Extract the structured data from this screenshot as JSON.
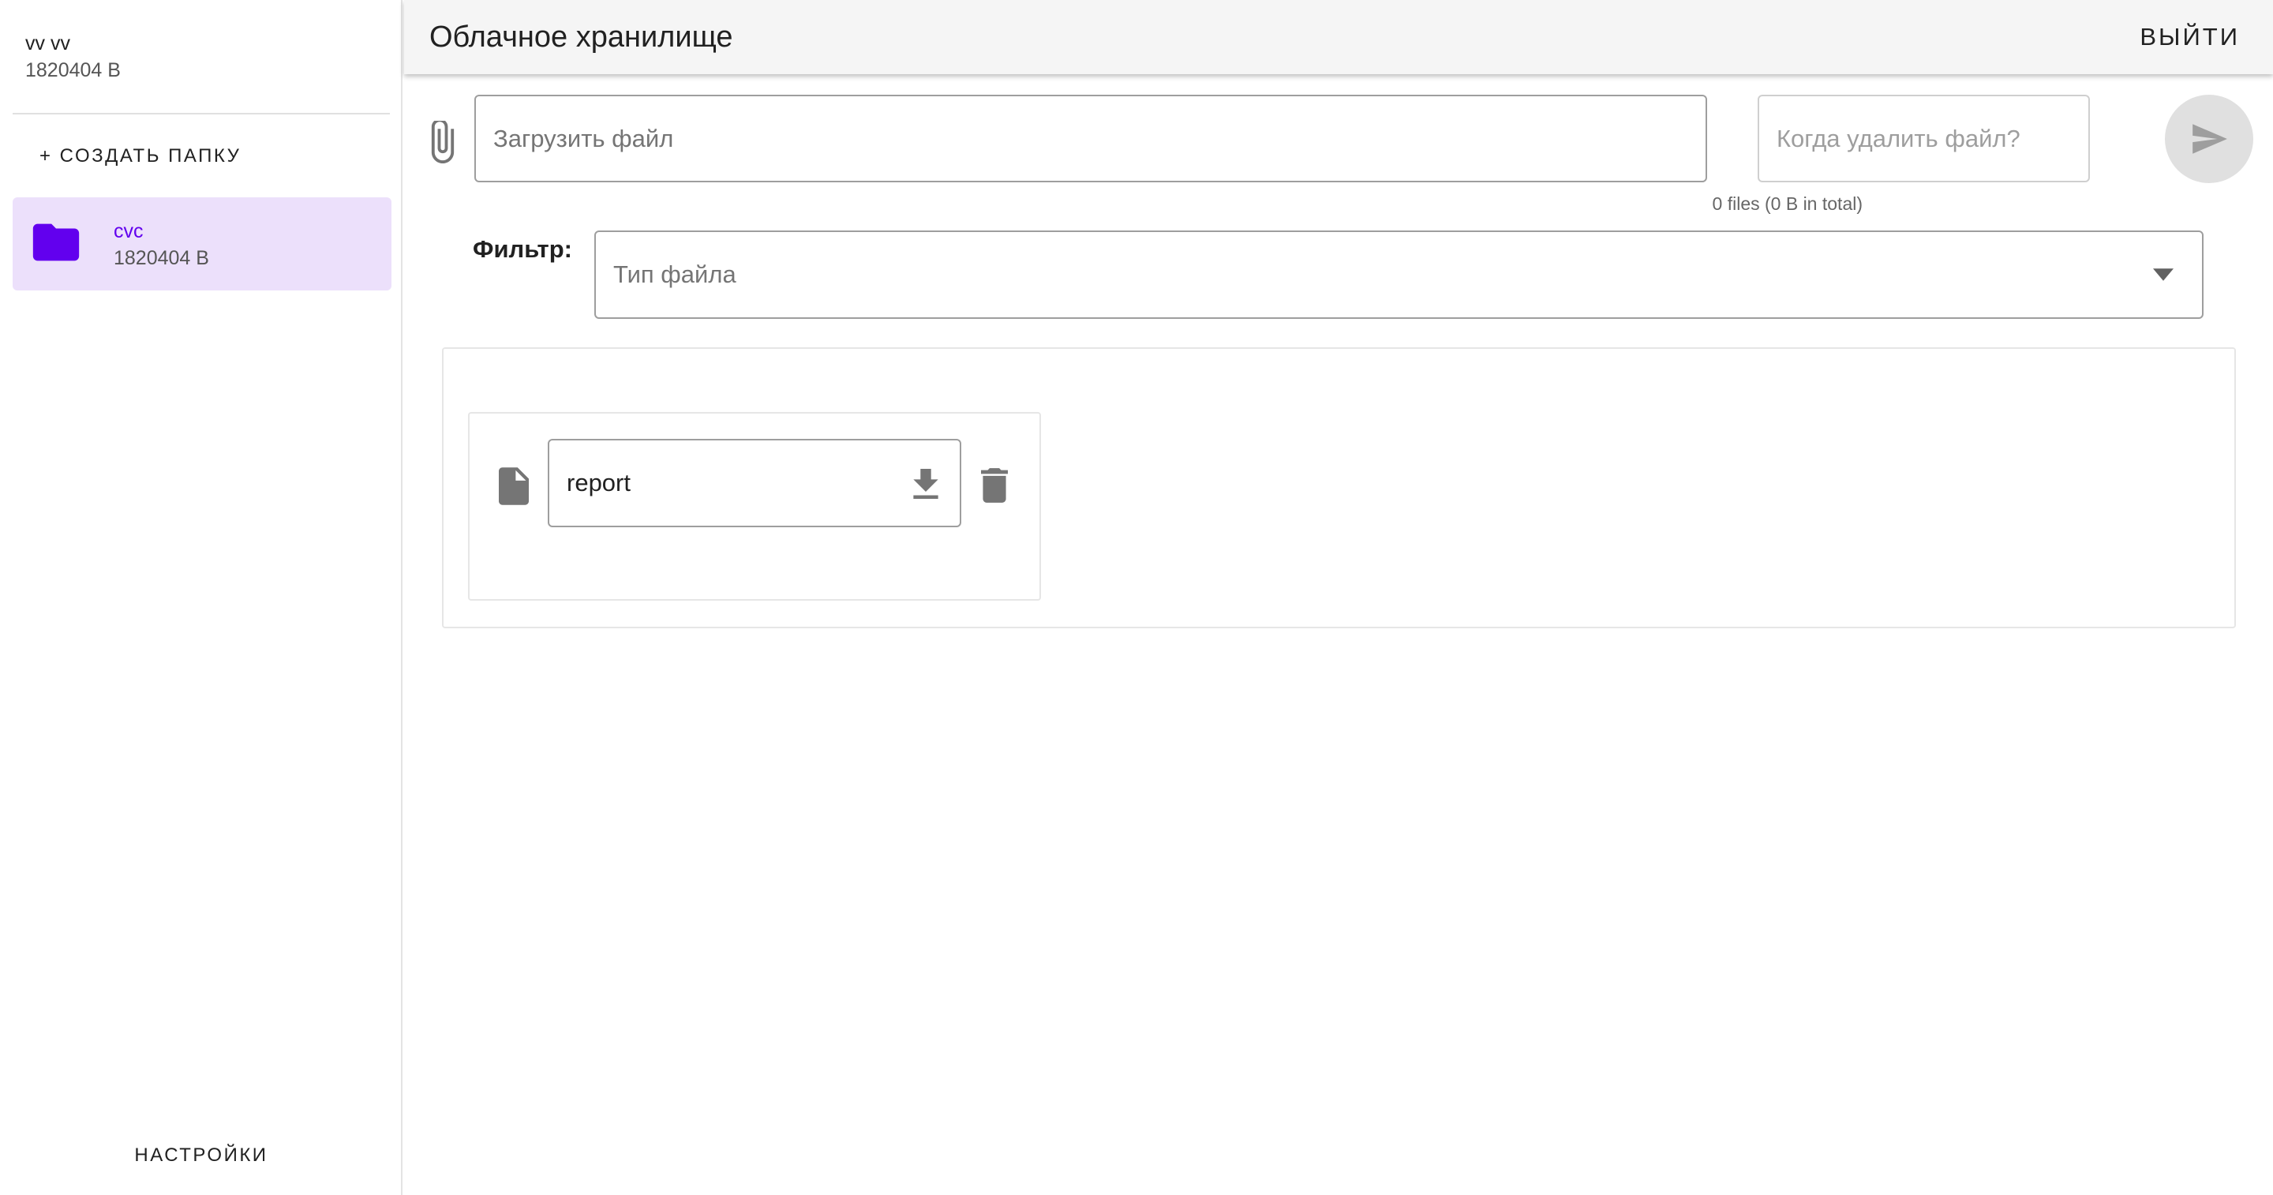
{
  "sidebar": {
    "user_name": "vv vv",
    "user_size": "1820404 B",
    "create_folder_label": "+ СОЗДАТЬ ПАПКУ",
    "folders": [
      {
        "name": "cvc",
        "size": "1820404 B",
        "selected": true
      }
    ],
    "settings_label": "НАСТРОЙКИ"
  },
  "header": {
    "title": "Облачное хранилище",
    "logout_label": "ВЫЙТИ"
  },
  "upload": {
    "file_placeholder": "Загрузить файл",
    "files_summary": "0 files (0 B in total)",
    "delete_when_placeholder": "Когда удалить файл?"
  },
  "filter": {
    "label": "Фильтр:",
    "placeholder": "Тип файла"
  },
  "files": [
    {
      "name": "report"
    }
  ],
  "colors": {
    "accent": "#6200ee",
    "selected_folder_bg": "#ece0fb",
    "header_bg": "#f5f5f5",
    "icon_gray": "#757575",
    "send_button_bg": "#e0e0e0"
  },
  "icons": {
    "folder": "folder-icon",
    "attach": "paperclip-icon",
    "send": "send-icon",
    "dropdown": "chevron-down-icon",
    "file": "file-icon",
    "download": "download-icon",
    "delete": "trash-icon"
  }
}
